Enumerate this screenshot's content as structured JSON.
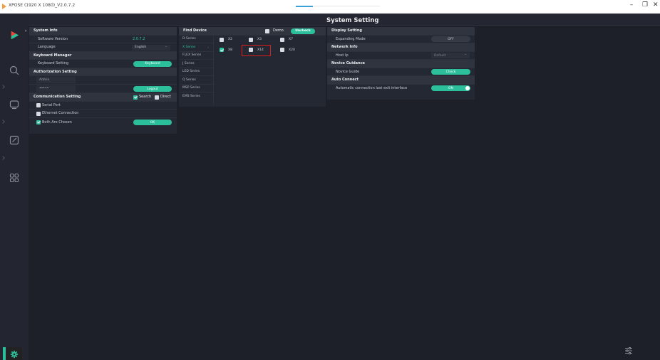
{
  "app": {
    "title": "XPOSE (1920 X 1080)_V2.0.7.2"
  },
  "window": {
    "minimize": "–",
    "maximize": "❐",
    "close": "✕"
  },
  "header": {
    "title": "System Setting"
  },
  "system_info": {
    "heading": "System Info",
    "software_version_label": "Software Version",
    "software_version_value": "2.0.7.2",
    "language_label": "Language",
    "language_value": "English"
  },
  "keyboard_manager": {
    "heading": "Keyboard Manager",
    "setting_label": "Keyboard Setting",
    "button": "Keyboard"
  },
  "authorization": {
    "heading": "Authorization Setting",
    "user_placeholder": "Admin",
    "password_value": "•••••",
    "logout_button": "Logout"
  },
  "communication": {
    "heading": "Communication Setting",
    "search_label": "Search",
    "direct_label": "Direct",
    "options": [
      "Serial Port",
      "Ethernet Connection",
      "Both Are Chosen"
    ],
    "ok_button": "OK"
  },
  "find_device": {
    "heading": "Find Device",
    "demo_label": "Demo",
    "uncheck_button": "Uncheck",
    "series": [
      "D Series",
      "X Series",
      "FLEX Series",
      "J Series",
      "LED Series",
      "Q Series",
      "MSP Series",
      "EMS Series"
    ],
    "devices_row1": [
      "X2",
      "X3",
      "X7"
    ],
    "devices_row2": [
      "X8",
      "X14",
      "X20"
    ]
  },
  "display_setting": {
    "heading": "Display Setting",
    "expanding_mode_label": "Expanding Mode",
    "expanding_mode_value": "OFF"
  },
  "network_info": {
    "heading": "Network Info",
    "host_ip_label": "Host Ip",
    "host_ip_value": "Default"
  },
  "novice_guidance": {
    "heading": "Novice Guidance",
    "guide_label": "Novice Guide",
    "check_button": "Check"
  },
  "auto_connect": {
    "heading": "Auto Connect",
    "label": "Automatic connection last exit interface",
    "toggle_value": "ON"
  },
  "colors": {
    "accent": "#2bbf9b",
    "highlight_box": "#e01c1c",
    "background": "#1c1f27"
  }
}
